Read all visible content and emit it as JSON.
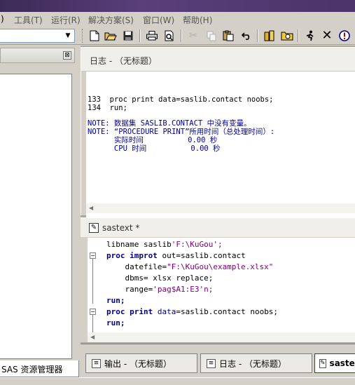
{
  "menu": {
    "items": [
      {
        "label": ")"
      },
      {
        "label": "工具(T)"
      },
      {
        "label": "运行(R)"
      },
      {
        "label": "解决方案(S)"
      },
      {
        "label": "窗口(W)"
      },
      {
        "label": "帮助(H)"
      }
    ]
  },
  "toolbar": {
    "command_value": "",
    "icons": [
      "new-icon",
      "open-icon",
      "save-icon",
      "print-icon",
      "print-preview-icon",
      "cut-icon",
      "copy-icon",
      "paste-icon",
      "undo-icon",
      "libraries-icon",
      "explorer-icon",
      "run-icon",
      "clear-icon",
      "help-icon"
    ]
  },
  "explorer": {
    "close_glyph": "⊠",
    "tab_label": "SAS 资源管理器"
  },
  "log": {
    "title": "日志 - （无标题）",
    "lines": [
      {
        "text": "133  proc print data=saslib.contact noobs;",
        "type": "source"
      },
      {
        "text": "134  run;",
        "type": "source"
      },
      {
        "text": "",
        "type": "blank"
      },
      {
        "text": "NOTE: 数据集 SASLIB.CONTACT 中没有变量。",
        "type": "note"
      },
      {
        "text": "NOTE: “PROCEDURE PRINT”所用时间（总处理时间）:",
        "type": "note"
      },
      {
        "text": "      实际时间          0.00 秒",
        "type": "note"
      },
      {
        "text": "      CPU 时间          0.00 秒",
        "type": "note"
      }
    ]
  },
  "program": {
    "title": "sastext *",
    "code": {
      "l1_a": "libname saslib",
      "l1_b": "'F:\\KuGou';",
      "l2_kw": "proc improt",
      "l2_rest": " out=saslib.contact",
      "l3_a": "    datefile=",
      "l3_b": "\"F:\\KuGou\\example.xlsx\"",
      "l4": "    dbms= xlsx replace;",
      "l5_a": "    range=",
      "l5_b": "'pag$A1:E3'n;",
      "l6": "run;",
      "l7_kw": "proc print",
      "l7_opt": " data",
      "l7_rest": "=saslib.contact noobs;",
      "l8": "run;"
    }
  },
  "tabs": [
    {
      "label": "输出 - （无标题）"
    },
    {
      "label": "日志 - （无标题）"
    },
    {
      "label": "sastext"
    }
  ]
}
